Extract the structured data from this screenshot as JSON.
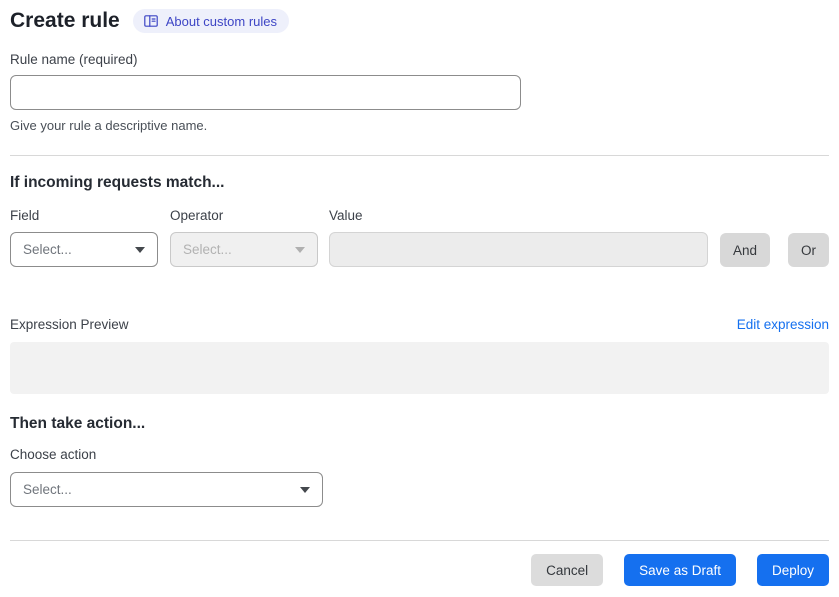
{
  "header": {
    "title": "Create rule",
    "about_label": "About custom rules"
  },
  "rule_name": {
    "label": "Rule name (required)",
    "value": "",
    "helper": "Give your rule a descriptive name."
  },
  "match": {
    "heading": "If incoming requests match...",
    "field_label": "Field",
    "field_value": "Select...",
    "operator_label": "Operator",
    "operator_value": "Select...",
    "value_label": "Value",
    "value_value": "",
    "and_label": "And",
    "or_label": "Or"
  },
  "expression": {
    "label": "Expression Preview",
    "edit_label": "Edit expression",
    "content": ""
  },
  "action": {
    "heading": "Then take action...",
    "label": "Choose action",
    "value": "Select..."
  },
  "footer": {
    "cancel_label": "Cancel",
    "save_label": "Save as Draft",
    "deploy_label": "Deploy"
  },
  "colors": {
    "primary_blue": "#1570ef",
    "link_blue": "#1570ef",
    "pill_bg": "#eef0fb",
    "pill_text": "#3d45c5",
    "disabled_bg": "#f0f0f0",
    "neutral_button_bg": "#d8d8d8"
  },
  "icons": {
    "about": "book-icon",
    "dropdown": "chevron-down-icon"
  }
}
